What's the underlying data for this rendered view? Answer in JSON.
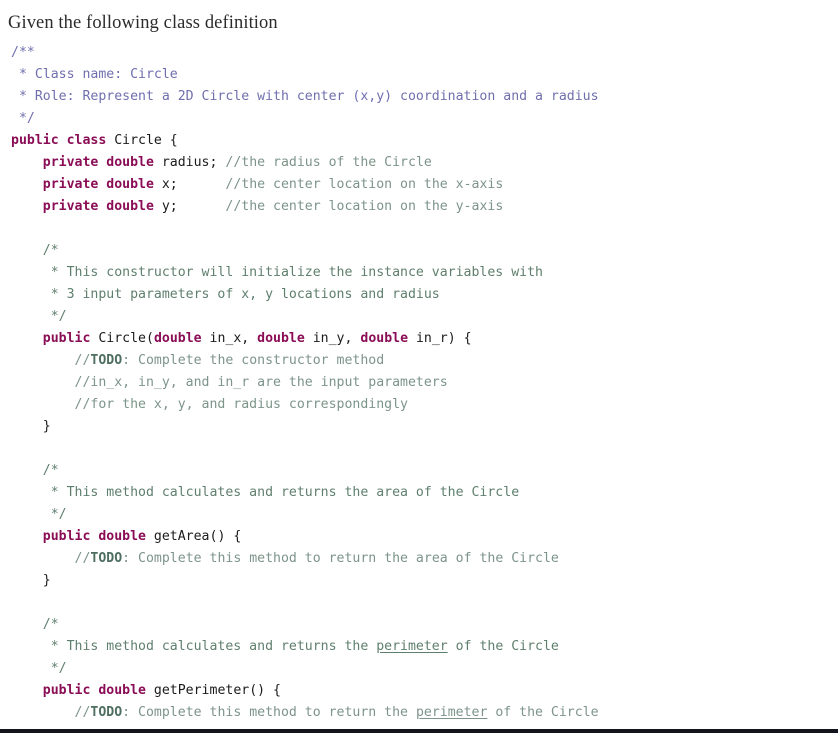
{
  "document": {
    "heading": "Given the following class definition",
    "language": "java",
    "colors": {
      "background": "#ffffff",
      "text": "#1b1b1b",
      "keyword": "#8a0d56",
      "javadoc_comment": "#6f6fae",
      "block_comment": "#5f7f6e",
      "line_comment": "#7d948a",
      "todo_tag": "#4e6e60",
      "bottom_bar": "#14141e"
    }
  },
  "code": {
    "lines": [
      [
        {
          "t": "/**",
          "c": "javadoc"
        }
      ],
      [
        {
          "t": " * Class name: Circle",
          "c": "javadoc"
        }
      ],
      [
        {
          "t": " * Role: Represent a 2D Circle with center (x,y) coordination and a radius",
          "c": "javadoc"
        }
      ],
      [
        {
          "t": " */",
          "c": "javadoc"
        }
      ],
      [
        {
          "t": "public class",
          "c": "kw"
        },
        {
          "t": " Circle {",
          "c": "plain"
        }
      ],
      [
        {
          "t": "    ",
          "c": "plain"
        },
        {
          "t": "private double",
          "c": "kw"
        },
        {
          "t": " radius; ",
          "c": "plain"
        },
        {
          "t": "//the radius of the Circle",
          "c": "linecmt"
        }
      ],
      [
        {
          "t": "    ",
          "c": "plain"
        },
        {
          "t": "private double",
          "c": "kw"
        },
        {
          "t": " x;      ",
          "c": "plain"
        },
        {
          "t": "//the center location on the x-axis",
          "c": "linecmt"
        }
      ],
      [
        {
          "t": "    ",
          "c": "plain"
        },
        {
          "t": "private double",
          "c": "kw"
        },
        {
          "t": " y;      ",
          "c": "plain"
        },
        {
          "t": "//the center location on the y-axis",
          "c": "linecmt"
        }
      ],
      [
        {
          "t": "",
          "c": "plain"
        }
      ],
      [
        {
          "t": "    /*",
          "c": "blockcmt"
        }
      ],
      [
        {
          "t": "     * This constructor will initialize the instance variables with",
          "c": "blockcmt"
        }
      ],
      [
        {
          "t": "     * 3 input parameters of x, y locations and radius",
          "c": "blockcmt"
        }
      ],
      [
        {
          "t": "     */",
          "c": "blockcmt"
        }
      ],
      [
        {
          "t": "    ",
          "c": "plain"
        },
        {
          "t": "public",
          "c": "kw"
        },
        {
          "t": " Circle(",
          "c": "plain"
        },
        {
          "t": "double",
          "c": "kw"
        },
        {
          "t": " in_x, ",
          "c": "plain"
        },
        {
          "t": "double",
          "c": "kw"
        },
        {
          "t": " in_y, ",
          "c": "plain"
        },
        {
          "t": "double",
          "c": "kw"
        },
        {
          "t": " in_r) {",
          "c": "plain"
        }
      ],
      [
        {
          "t": "        //",
          "c": "linecmt"
        },
        {
          "t": "TODO",
          "c": "todo"
        },
        {
          "t": ": Complete the constructor method",
          "c": "linecmt"
        }
      ],
      [
        {
          "t": "        //in_x, in_y, and in_r are the input parameters",
          "c": "linecmt"
        }
      ],
      [
        {
          "t": "        //for the x, y, and radius correspondingly",
          "c": "linecmt"
        }
      ],
      [
        {
          "t": "    }",
          "c": "plain"
        }
      ],
      [
        {
          "t": "",
          "c": "plain"
        }
      ],
      [
        {
          "t": "    /*",
          "c": "blockcmt"
        }
      ],
      [
        {
          "t": "     * This method calculates and returns the area of the Circle",
          "c": "blockcmt"
        }
      ],
      [
        {
          "t": "     */",
          "c": "blockcmt"
        }
      ],
      [
        {
          "t": "    ",
          "c": "plain"
        },
        {
          "t": "public double",
          "c": "kw"
        },
        {
          "t": " getArea() {",
          "c": "plain"
        }
      ],
      [
        {
          "t": "        //",
          "c": "linecmt"
        },
        {
          "t": "TODO",
          "c": "todo"
        },
        {
          "t": ": Complete this method to return the area of the Circle",
          "c": "linecmt"
        }
      ],
      [
        {
          "t": "    }",
          "c": "plain"
        }
      ],
      [
        {
          "t": "",
          "c": "plain"
        }
      ],
      [
        {
          "t": "    /*",
          "c": "blockcmt"
        }
      ],
      [
        {
          "t": "     * This method calculates and returns the ",
          "c": "blockcmt"
        },
        {
          "t": "perimeter",
          "c": "blockcmt-spell"
        },
        {
          "t": " of the Circle",
          "c": "blockcmt"
        }
      ],
      [
        {
          "t": "     */",
          "c": "blockcmt"
        }
      ],
      [
        {
          "t": "    ",
          "c": "plain"
        },
        {
          "t": "public double",
          "c": "kw"
        },
        {
          "t": " getPerimeter() {",
          "c": "plain"
        }
      ],
      [
        {
          "t": "        //",
          "c": "linecmt"
        },
        {
          "t": "TODO",
          "c": "todo"
        },
        {
          "t": ": Complete this method to return the ",
          "c": "linecmt"
        },
        {
          "t": "perimeter",
          "c": "linecmt-spell"
        },
        {
          "t": " of the Circle",
          "c": "linecmt"
        }
      ]
    ]
  }
}
